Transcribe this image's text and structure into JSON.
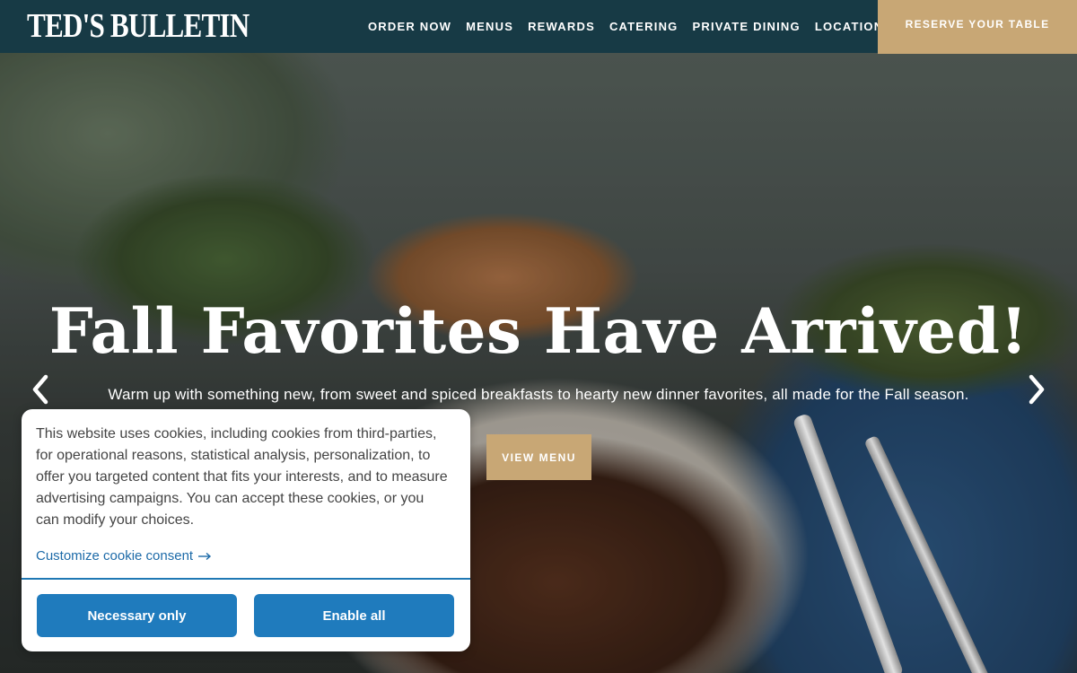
{
  "header": {
    "logo": "TED'S BULLETIN",
    "nav": [
      "ORDER NOW",
      "MENUS",
      "REWARDS",
      "CATERING",
      "PRIVATE DINING",
      "LOCATIONS"
    ],
    "reserve_label": "RESERVE YOUR TABLE"
  },
  "hero": {
    "title": "Fall Favorites Have Arrived!",
    "subtitle": "Warm up with something new, from sweet and spiced breakfasts to hearty new dinner favorites, all made for the Fall season.",
    "cta_label": "VIEW MENU",
    "prev_icon": "chevron-left-icon",
    "next_icon": "chevron-right-icon"
  },
  "cookie": {
    "text": "This website uses cookies, including cookies from third-parties, for operational reasons, statistical analysis, personalization, to offer you targeted content that fits your interests, and to measure advertising campaigns. You can accept these cookies, or you can modify your choices.",
    "customize_label": "Customize cookie consent",
    "necessary_label": "Necessary only",
    "enable_label": "Enable all"
  },
  "colors": {
    "header_bg": "#173a45",
    "accent_gold": "#c8a775",
    "cookie_button": "#1f7bbd",
    "link_blue": "#1c6aa8"
  }
}
